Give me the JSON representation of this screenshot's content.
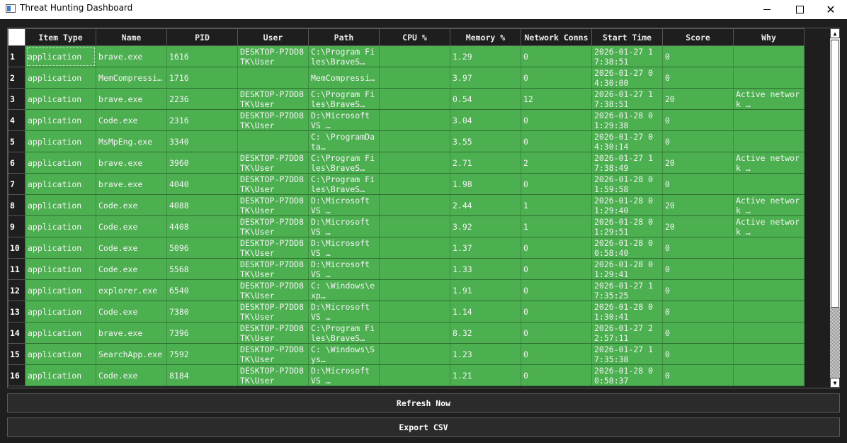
{
  "window": {
    "title": "Threat Hunting Dashboard"
  },
  "table": {
    "columns": [
      "Item Type",
      "Name",
      "PID",
      "User",
      "Path",
      "CPU %",
      "Memory %",
      "Network Conns",
      "Start Time",
      "Score",
      "Why"
    ],
    "rows": [
      [
        "1",
        "application",
        "brave.exe",
        "1616",
        "DESKTOP-P7DD8TK\\User",
        "C:\\Program Files\\BraveS…",
        "",
        "1.29",
        "0",
        "2026-01-27 17:38:51",
        "0",
        ""
      ],
      [
        "2",
        "application",
        "MemCompressi…",
        "1716",
        "",
        "MemCompressi…",
        "",
        "3.97",
        "0",
        "2026-01-27 04:30:00",
        "0",
        ""
      ],
      [
        "3",
        "application",
        "brave.exe",
        "2236",
        "DESKTOP-P7DD8TK\\User",
        "C:\\Program Files\\BraveS…",
        "",
        "0.54",
        "12",
        "2026-01-27 17:38:51",
        "20",
        "Active network …"
      ],
      [
        "4",
        "application",
        "Code.exe",
        "2316",
        "DESKTOP-P7DD8TK\\User",
        "D:\\Microsoft VS …",
        "",
        "3.04",
        "0",
        "2026-01-28 01:29:38",
        "0",
        ""
      ],
      [
        "5",
        "application",
        "MsMpEng.exe",
        "3340",
        "",
        "C: \\ProgramData…",
        "",
        "3.55",
        "0",
        "2026-01-27 04:30:14",
        "0",
        ""
      ],
      [
        "6",
        "application",
        "brave.exe",
        "3960",
        "DESKTOP-P7DD8TK\\User",
        "C:\\Program Files\\BraveS…",
        "",
        "2.71",
        "2",
        "2026-01-27 17:38:49",
        "20",
        "Active network …"
      ],
      [
        "7",
        "application",
        "brave.exe",
        "4040",
        "DESKTOP-P7DD8TK\\User",
        "C:\\Program Files\\BraveS…",
        "",
        "1.98",
        "0",
        "2026-01-28 01:59:58",
        "0",
        ""
      ],
      [
        "8",
        "application",
        "Code.exe",
        "4088",
        "DESKTOP-P7DD8TK\\User",
        "D:\\Microsoft VS …",
        "",
        "2.44",
        "1",
        "2026-01-28 01:29:40",
        "20",
        "Active network …"
      ],
      [
        "9",
        "application",
        "Code.exe",
        "4408",
        "DESKTOP-P7DD8TK\\User",
        "D:\\Microsoft VS …",
        "",
        "3.92",
        "1",
        "2026-01-28 01:29:51",
        "20",
        "Active network …"
      ],
      [
        "10",
        "application",
        "Code.exe",
        "5096",
        "DESKTOP-P7DD8TK\\User",
        "D:\\Microsoft VS …",
        "",
        "1.37",
        "0",
        "2026-01-28 00:58:40",
        "0",
        ""
      ],
      [
        "11",
        "application",
        "Code.exe",
        "5568",
        "DESKTOP-P7DD8TK\\User",
        "D:\\Microsoft VS …",
        "",
        "1.33",
        "0",
        "2026-01-28 01:29:41",
        "0",
        ""
      ],
      [
        "12",
        "application",
        "explorer.exe",
        "6540",
        "DESKTOP-P7DD8TK\\User",
        "C: \\Windows\\exp…",
        "",
        "1.91",
        "0",
        "2026-01-27 17:35:25",
        "0",
        ""
      ],
      [
        "13",
        "application",
        "Code.exe",
        "7380",
        "DESKTOP-P7DD8TK\\User",
        "D:\\Microsoft VS …",
        "",
        "1.14",
        "0",
        "2026-01-28 01:30:41",
        "0",
        ""
      ],
      [
        "14",
        "application",
        "brave.exe",
        "7396",
        "DESKTOP-P7DD8TK\\User",
        "C:\\Program Files\\BraveS…",
        "",
        "8.32",
        "0",
        "2026-01-27 22:57:11",
        "0",
        ""
      ],
      [
        "15",
        "application",
        "SearchApp.exe",
        "7592",
        "DESKTOP-P7DD8TK\\User",
        "C: \\Windows\\Sys…",
        "",
        "1.23",
        "0",
        "2026-01-27 17:35:38",
        "0",
        ""
      ],
      [
        "16",
        "application",
        "Code.exe",
        "8184",
        "DESKTOP-P7DD8TK\\User",
        "D:\\Microsoft VS …",
        "",
        "1.21",
        "0",
        "2026-01-28 00:58:37",
        "0",
        ""
      ]
    ]
  },
  "buttons": {
    "refresh": "Refresh Now",
    "export": "Export CSV"
  }
}
